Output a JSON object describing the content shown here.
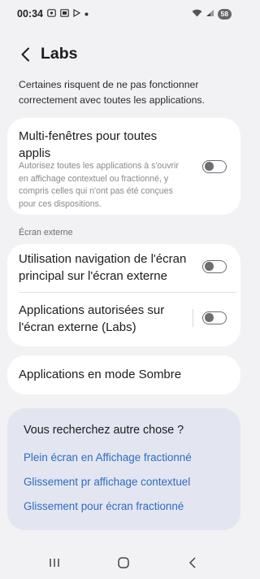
{
  "status_bar": {
    "time": "00:34",
    "battery": "58",
    "left_icons": [
      "screen-record-icon",
      "screenshot-icon",
      "play-icon",
      "dot-icon"
    ],
    "right_icons": [
      "wifi-icon",
      "signal-icon",
      "battery-icon"
    ]
  },
  "header": {
    "title": "Labs"
  },
  "description": "Certaines risquent de ne pas fonctionner correctement avec toutes les applications.",
  "settings": {
    "multi_window": {
      "title": "Multi-fenêtres pour toutes applis",
      "subtitle": "Autorisez toutes les applications à s'ouvrir en affichage contextuel ou fractionné, y compris celles qui n'ont pas été conçues pour ces dispositions.",
      "enabled": false
    },
    "external_section_label": "Écran externe",
    "external_nav": {
      "title": "Utilisation navigation de l'écran principal sur l'écran externe",
      "enabled": false
    },
    "external_apps": {
      "title": "Applications autorisées sur l'écran externe (Labs)",
      "enabled": false
    },
    "dark_mode_apps": {
      "title": "Applications en mode Sombre"
    }
  },
  "suggestions": {
    "title": "Vous recherchez autre chose ?",
    "links": [
      "Plein écran en Affichage fractionné",
      "Glissement pr affichage contextuel",
      "Glissement pour écran fractionné"
    ]
  },
  "colors": {
    "background": "#f2f2f4",
    "card": "#ffffff",
    "suggest_card": "#e3e6f1",
    "link": "#2f6bc0",
    "toggle_off": "#6d6d72"
  }
}
